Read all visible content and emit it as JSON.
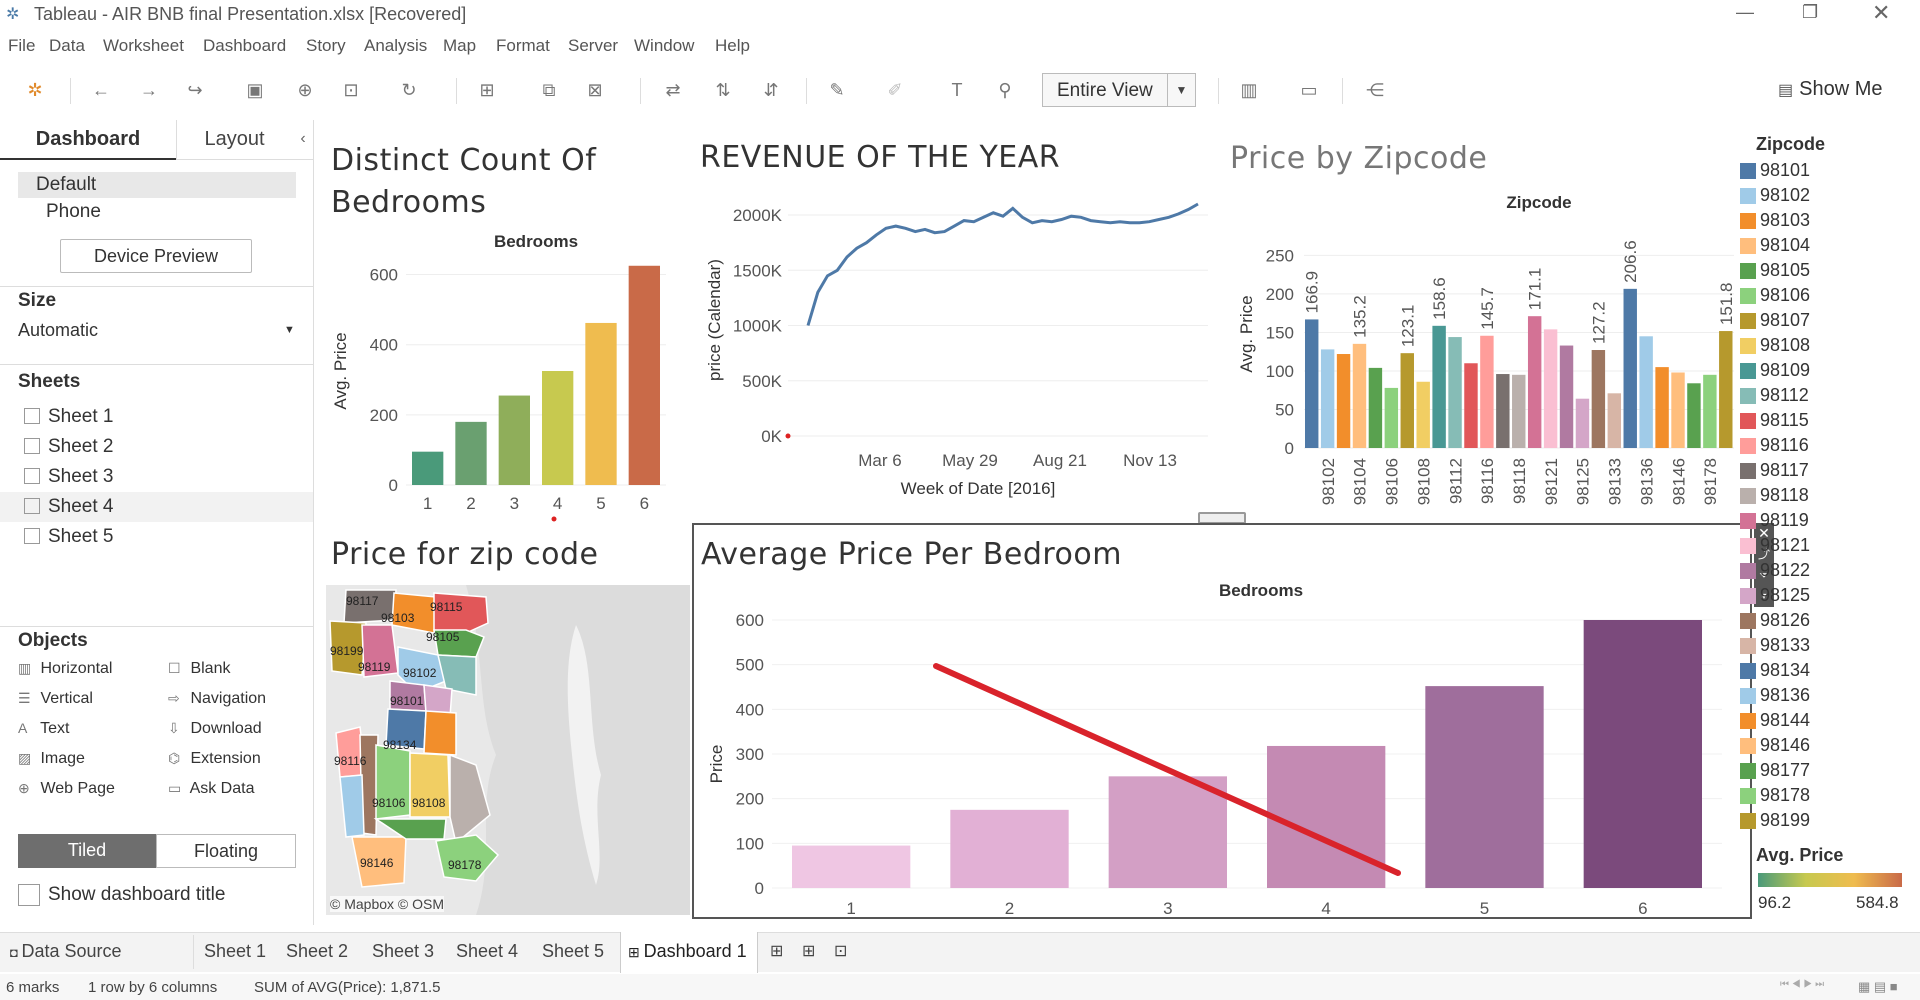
{
  "window": {
    "title": "Tableau - AIR BNB final Presentation.xlsx [Recovered]"
  },
  "menu": [
    "File",
    "Data",
    "Worksheet",
    "Dashboard",
    "Story",
    "Analysis",
    "Map",
    "Format",
    "Server",
    "Window",
    "Help"
  ],
  "toolbar": {
    "fit_value": "Entire View",
    "show_me": "Show Me"
  },
  "left_pane": {
    "tabs": [
      "Dashboard",
      "Layout"
    ],
    "devices": [
      "Default",
      "Phone"
    ],
    "device_preview": "Device Preview",
    "size_title": "Size",
    "size_value": "Automatic",
    "sheets_title": "Sheets",
    "sheets": [
      "Sheet 1",
      "Sheet 2",
      "Sheet 3",
      "Sheet 4",
      "Sheet 5"
    ],
    "objects_title": "Objects",
    "objects": [
      {
        "label": "Horizontal",
        "icon": "horizontal-icon"
      },
      {
        "label": "Blank",
        "icon": "blank-icon"
      },
      {
        "label": "Vertical",
        "icon": "vertical-icon"
      },
      {
        "label": "Navigation",
        "icon": "navigation-icon"
      },
      {
        "label": "Text",
        "icon": "text-icon"
      },
      {
        "label": "Download",
        "icon": "download-icon"
      },
      {
        "label": "Image",
        "icon": "image-icon"
      },
      {
        "label": "Extension",
        "icon": "extension-icon"
      },
      {
        "label": "Web Page",
        "icon": "web-page-icon"
      },
      {
        "label": "Ask Data",
        "icon": "ask-data-icon"
      }
    ],
    "tiled": "Tiled",
    "floating": "Floating",
    "show_title": "Show dashboard title"
  },
  "chart_data": [
    {
      "id": "bedrooms",
      "type": "bar",
      "title": "Distinct Count Of Bedrooms",
      "header": "Bedrooms",
      "ylabel": "Avg. Price",
      "categories": [
        "1",
        "2",
        "3",
        "4",
        "5",
        "6"
      ],
      "values": [
        95,
        180,
        255,
        325,
        462,
        625
      ],
      "ylim": [
        0,
        650
      ],
      "yticks": [
        "0",
        "200",
        "400",
        "600"
      ],
      "colors": [
        "#4a9a7a",
        "#6aa070",
        "#8fae5a",
        "#c7c94f",
        "#efbc4f",
        "#c96a48"
      ]
    },
    {
      "id": "revenue",
      "type": "line",
      "title": "REVENUE OF THE YEAR",
      "ylabel": "price (Calendar)",
      "xlabel": "Week of Date [2016]",
      "yticks": [
        "0K",
        "500K",
        "1000K",
        "1500K",
        "2000K"
      ],
      "xticks": [
        "Mar 6",
        "May 29",
        "Aug 21",
        "Nov 13"
      ],
      "ylim": [
        0,
        2100
      ],
      "values": [
        1000,
        1300,
        1450,
        1500,
        1620,
        1700,
        1750,
        1820,
        1880,
        1900,
        1880,
        1850,
        1870,
        1840,
        1850,
        1900,
        1950,
        1940,
        1980,
        2020,
        1990,
        2060,
        1980,
        1930,
        1950,
        1940,
        1960,
        1990,
        1980,
        1950,
        1940,
        1930,
        1940,
        1930,
        1930,
        1940,
        1960,
        1980,
        2010,
        2050,
        2100
      ],
      "color": "#4e79a7"
    },
    {
      "id": "zipcode",
      "type": "bar",
      "title": "Price by Zipcode",
      "header": "Zipcode",
      "ylabel": "Avg. Price",
      "ylim": [
        0,
        270
      ],
      "yticks": [
        "0",
        "50",
        "100",
        "150",
        "200",
        "250"
      ],
      "x_tick_labels": [
        "98102",
        "98104",
        "98106",
        "98108",
        "98112",
        "98116",
        "98118",
        "98121",
        "98125",
        "98133",
        "98136",
        "98146",
        "98178"
      ],
      "values": [
        166.9,
        128,
        122,
        135.2,
        104,
        78,
        123.1,
        86,
        158.6,
        144,
        110,
        145.7,
        96,
        95,
        171.1,
        154,
        133,
        64,
        127.2,
        71,
        206.6,
        145,
        105,
        98,
        84,
        95,
        151.8
      ],
      "data_labels": [
        "166.9",
        "",
        "",
        "135.2",
        "",
        "",
        "123.1",
        "",
        "158.6",
        "",
        "",
        "145.7",
        "",
        "",
        "171.1",
        "",
        "",
        "",
        "127.2",
        "",
        "206.6",
        "",
        "",
        "",
        "",
        "",
        "151.8"
      ],
      "colors": [
        "#4e79a7",
        "#a0cbe8",
        "#f28e2b",
        "#ffbe7d",
        "#59a14f",
        "#8cd17d",
        "#b6992d",
        "#f1ce63",
        "#499894",
        "#86bcb6",
        "#e15759",
        "#ff9d9a",
        "#79706e",
        "#bab0ac",
        "#d37295",
        "#fabfd2",
        "#b07aa1",
        "#d4a6c8",
        "#9d7660",
        "#d7b5a6",
        "#4e79a7",
        "#a0cbe8",
        "#f28e2b",
        "#ffbe7d",
        "#59a14f",
        "#8cd17d",
        "#b6992d"
      ]
    },
    {
      "id": "avgprice",
      "type": "bar",
      "title": "Average Price Per Bedroom",
      "header": "Bedrooms",
      "ylabel": "Price",
      "categories": [
        "1",
        "2",
        "3",
        "4",
        "5",
        "6"
      ],
      "values": [
        95,
        175,
        250,
        318,
        452,
        600
      ],
      "ylim": [
        0,
        600
      ],
      "yticks": [
        "0",
        "100",
        "200",
        "300",
        "400",
        "500",
        "600"
      ],
      "colors": [
        "#efc6e3",
        "#e2b0d5",
        "#d39fc5",
        "#c48ab3",
        "#9f6e9c",
        "#7b4a7c"
      ]
    }
  ],
  "map": {
    "title": "Price for zip code",
    "attribution": "© Mapbox © OSM",
    "labels": [
      "98117",
      "98103",
      "98115",
      "98105",
      "98199",
      "98119",
      "98102",
      "98101",
      "98134",
      "98116",
      "98106",
      "98108",
      "98146",
      "98178"
    ]
  },
  "legend": {
    "title": "Zipcode",
    "items": [
      {
        "zip": "98101",
        "color": "#4e79a7"
      },
      {
        "zip": "98102",
        "color": "#a0cbe8"
      },
      {
        "zip": "98103",
        "color": "#f28e2b"
      },
      {
        "zip": "98104",
        "color": "#ffbe7d"
      },
      {
        "zip": "98105",
        "color": "#59a14f"
      },
      {
        "zip": "98106",
        "color": "#8cd17d"
      },
      {
        "zip": "98107",
        "color": "#b6992d"
      },
      {
        "zip": "98108",
        "color": "#f1ce63"
      },
      {
        "zip": "98109",
        "color": "#499894"
      },
      {
        "zip": "98112",
        "color": "#86bcb6"
      },
      {
        "zip": "98115",
        "color": "#e15759"
      },
      {
        "zip": "98116",
        "color": "#ff9d9a"
      },
      {
        "zip": "98117",
        "color": "#79706e"
      },
      {
        "zip": "98118",
        "color": "#bab0ac"
      },
      {
        "zip": "98119",
        "color": "#d37295"
      },
      {
        "zip": "98121",
        "color": "#fabfd2"
      },
      {
        "zip": "98122",
        "color": "#b07aa1"
      },
      {
        "zip": "98125",
        "color": "#d4a6c8"
      },
      {
        "zip": "98126",
        "color": "#9d7660"
      },
      {
        "zip": "98133",
        "color": "#d7b5a6"
      },
      {
        "zip": "98134",
        "color": "#4e79a7"
      },
      {
        "zip": "98136",
        "color": "#a0cbe8"
      },
      {
        "zip": "98144",
        "color": "#f28e2b"
      },
      {
        "zip": "98146",
        "color": "#ffbe7d"
      },
      {
        "zip": "98177",
        "color": "#59a14f"
      },
      {
        "zip": "98178",
        "color": "#8cd17d"
      },
      {
        "zip": "98199",
        "color": "#b6992d"
      }
    ],
    "gradient_title": "Avg. Price",
    "gradient_min": "96.2",
    "gradient_max": "584.8"
  },
  "bottom_tabs": [
    "Data Source",
    "Sheet 1",
    "Sheet 2",
    "Sheet 3",
    "Sheet 4",
    "Sheet 5",
    "Dashboard 1"
  ],
  "status": {
    "marks": "6 marks",
    "rows": "1 row by 6 columns",
    "sum": "SUM of AVG(Price): 1,871.5"
  }
}
